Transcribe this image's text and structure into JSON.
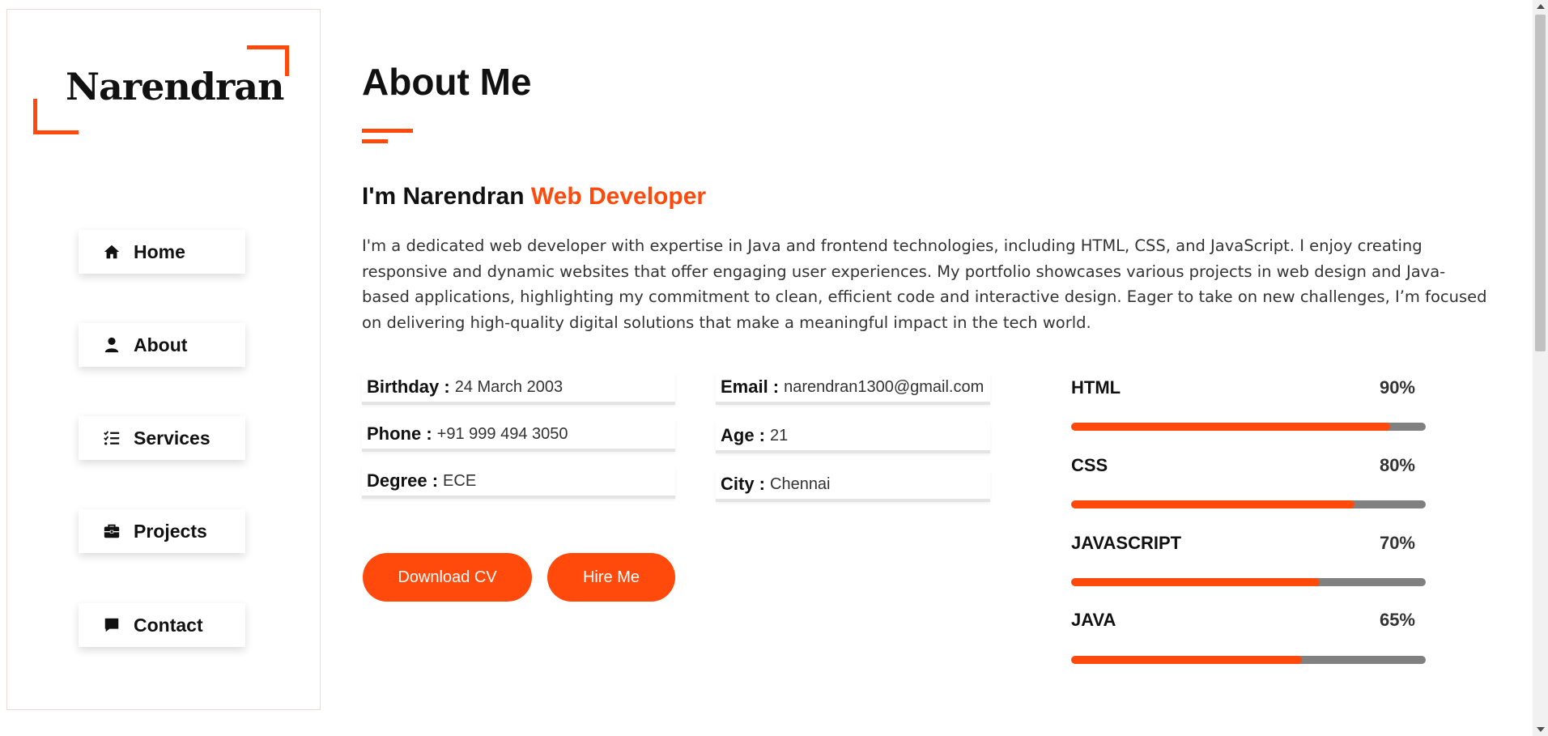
{
  "brand": {
    "name": "Narendran",
    "accent": "#ff4a0b"
  },
  "nav": {
    "items": [
      {
        "label": "Home",
        "icon": "home-icon"
      },
      {
        "label": "About",
        "icon": "user-icon"
      },
      {
        "label": "Services",
        "icon": "list-check-icon"
      },
      {
        "label": "Projects",
        "icon": "briefcase-icon"
      },
      {
        "label": "Contact",
        "icon": "message-icon"
      }
    ]
  },
  "about": {
    "title": "About Me",
    "intro": "I'm Narendran",
    "role": "Web Developer",
    "description": "I'm a dedicated web developer with expertise in Java and frontend technologies, including HTML, CSS, and JavaScript. I enjoy creating responsive and dynamic websites that offer engaging user experiences. My portfolio showcases various projects in web design and Java-based applications, highlighting my commitment to clean, efficient code and interactive design. Eager to take on new challenges, I’m focused on delivering high-quality digital solutions that make a meaningful impact in the tech world."
  },
  "info": {
    "birthday": {
      "label": "Birthday :",
      "value": "24 March 2003"
    },
    "phone": {
      "label": "Phone :",
      "value": "+91 999 494 3050"
    },
    "degree": {
      "label": "Degree :",
      "value": "ECE"
    },
    "email": {
      "label": "Email :",
      "value": "narendran1300@gmail.com"
    },
    "age": {
      "label": "Age :",
      "value": "21"
    },
    "city": {
      "label": "City :",
      "value": "Chennai"
    }
  },
  "buttons": {
    "download": "Download CV",
    "hire": "Hire Me"
  },
  "skills": [
    {
      "name": "HTML",
      "percent_label": "90%",
      "level": 0.9
    },
    {
      "name": "CSS",
      "percent_label": "80%",
      "level": 0.8
    },
    {
      "name": "JAVASCRIPT",
      "percent_label": "70%",
      "level": 0.7
    },
    {
      "name": "JAVA",
      "percent_label": "65%",
      "level": 0.65
    }
  ]
}
